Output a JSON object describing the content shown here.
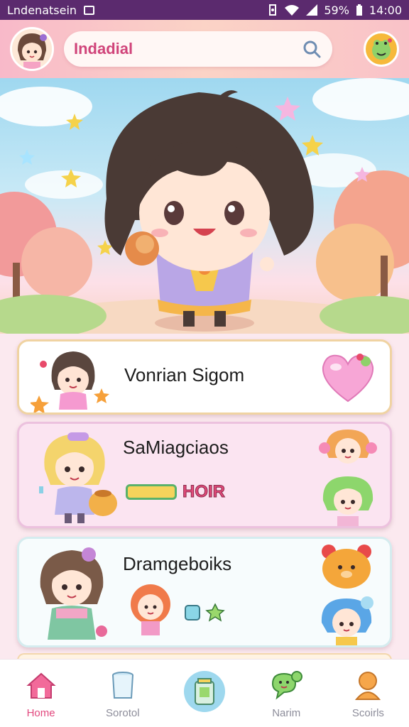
{
  "status_bar": {
    "carrier": "Lndenatsein",
    "battery": "59%",
    "time": "14:00"
  },
  "header": {
    "search_placeholder": "Indadial"
  },
  "cards": [
    {
      "title": "Vonrian Sigom"
    },
    {
      "title": "SaMiagciaos",
      "badge": "HOIR"
    },
    {
      "title": "Dramgeboiks"
    }
  ],
  "bottom_nav": [
    {
      "label": "Home",
      "icon": "home-icon",
      "active": true
    },
    {
      "label": "Sorotol",
      "icon": "cup-icon"
    },
    {
      "label": "",
      "icon": "jar-icon"
    },
    {
      "label": "Narim",
      "icon": "chat-bubble-icon"
    },
    {
      "label": "Scoirls",
      "icon": "person-icon"
    }
  ],
  "colors": {
    "status_bar": "#5b2a6e",
    "accent_pink": "#e2487e",
    "header_gradient": "#f8b9c9"
  }
}
